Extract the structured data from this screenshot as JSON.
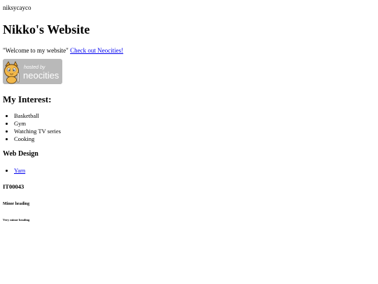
{
  "site": {
    "tab_title": "niksycayco",
    "heading": "Nikko's Website",
    "welcome_text": "\"Welcome to my website\"",
    "neocities_link": "Check out Neocities!",
    "badge": {
      "top_text": "hosted by",
      "bottom_text": "neocities",
      "bg_color": "#b9b9b9"
    }
  },
  "interests": {
    "heading": "My Interest:",
    "items": [
      "Basketball",
      "Gym",
      "Watching TV series",
      "Cooking"
    ]
  },
  "web_design": {
    "heading": "Web Design",
    "links": [
      "Yarn"
    ]
  },
  "extra_headings": {
    "h4": "IT00043",
    "h5": "Minor heading",
    "h6": "Very minor heading"
  },
  "colors": {
    "link": "#0000ee",
    "text": "#000000",
    "background": "#ffffff"
  }
}
